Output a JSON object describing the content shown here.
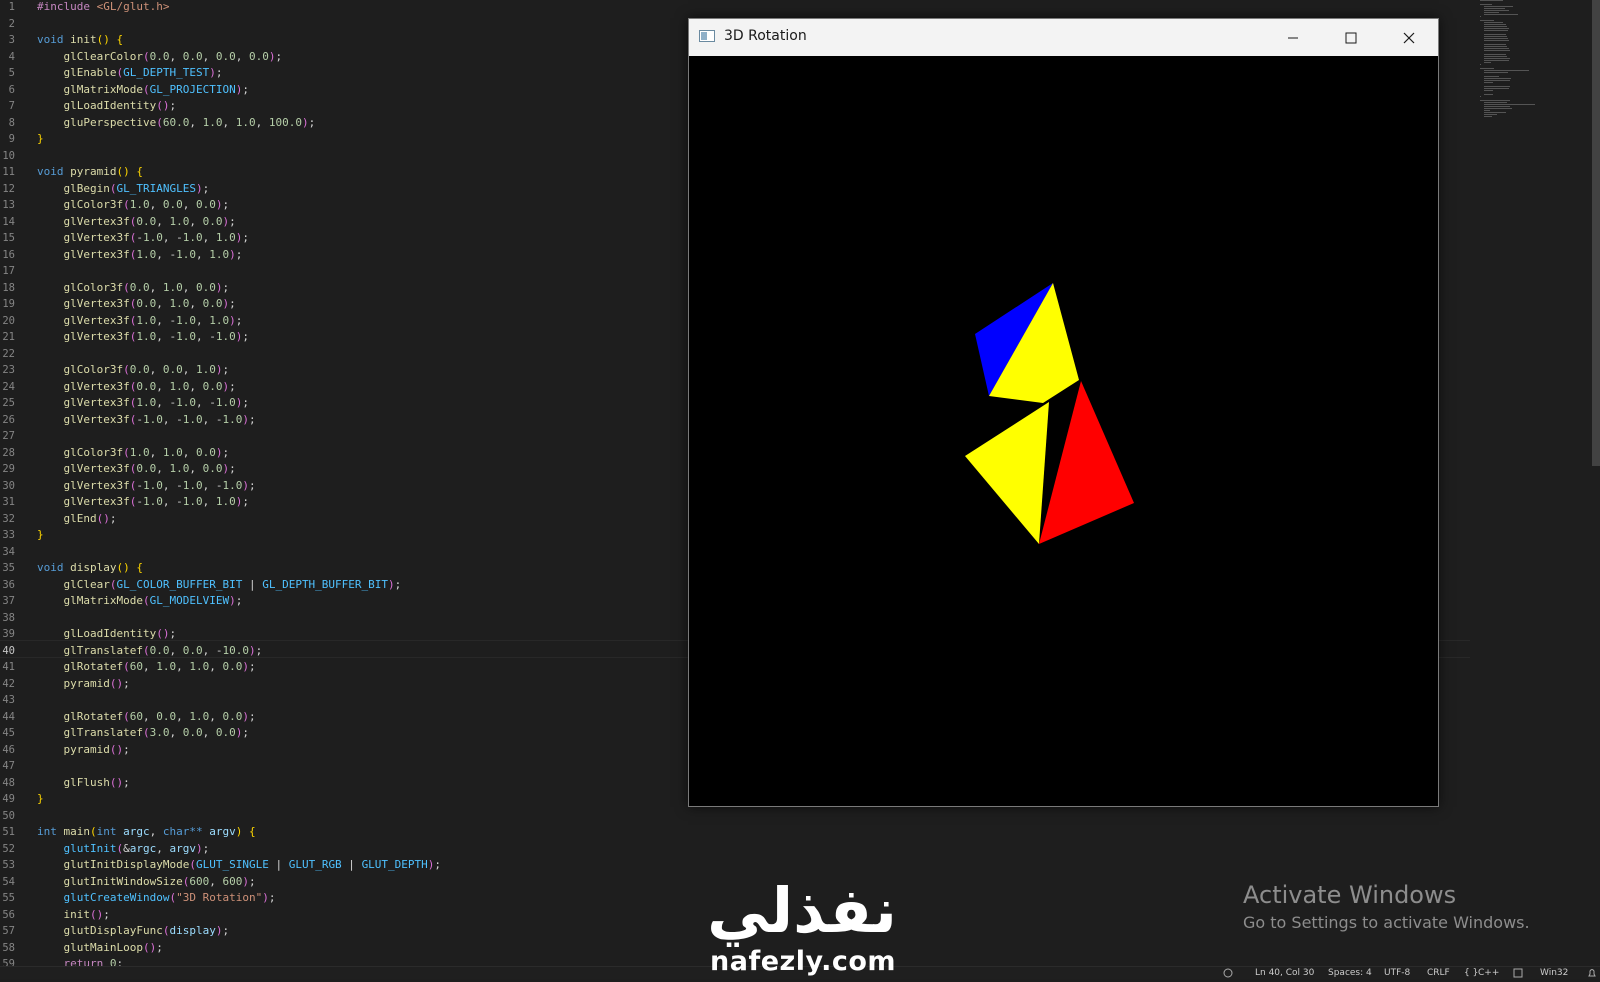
{
  "editor": {
    "active_line": "40",
    "lines": [
      {
        "n": "1",
        "html": "<span class='pre'>#include</span> <span class='s'>&lt;GL/glut.h&gt;</span>"
      },
      {
        "n": "2",
        "html": ""
      },
      {
        "n": "3",
        "html": "<span class='k'>void</span> <span class='f'>init</span><span class='b'>()</span> <span class='b'>{</span>"
      },
      {
        "n": "4",
        "html": "    <span class='f'>glClearColor</span><span class='b2'>(</span><span class='n'>0.0</span>, <span class='n'>0.0</span>, <span class='n'>0.0</span>, <span class='n'>0.0</span><span class='b2'>)</span>;"
      },
      {
        "n": "5",
        "html": "    <span class='f'>glEnable</span><span class='b2'>(</span><span class='c'>GL_DEPTH_TEST</span><span class='b2'>)</span>;"
      },
      {
        "n": "6",
        "html": "    <span class='f'>glMatrixMode</span><span class='b2'>(</span><span class='c'>GL_PROJECTION</span><span class='b2'>)</span>;"
      },
      {
        "n": "7",
        "html": "    <span class='f'>glLoadIdentity</span><span class='b2'>()</span>;"
      },
      {
        "n": "8",
        "html": "    <span class='f'>gluPerspective</span><span class='b2'>(</span><span class='n'>60.0</span>, <span class='n'>1.0</span>, <span class='n'>1.0</span>, <span class='n'>100.0</span><span class='b2'>)</span>;"
      },
      {
        "n": "9",
        "html": "<span class='b'>}</span>"
      },
      {
        "n": "10",
        "html": ""
      },
      {
        "n": "11",
        "html": "<span class='k'>void</span> <span class='f'>pyramid</span><span class='b'>()</span> <span class='b'>{</span>"
      },
      {
        "n": "12",
        "html": "    <span class='f'>glBegin</span><span class='b2'>(</span><span class='c'>GL_TRIANGLES</span><span class='b2'>)</span>;"
      },
      {
        "n": "13",
        "html": "    <span class='f'>glColor3f</span><span class='b2'>(</span><span class='n'>1.0</span>, <span class='n'>0.0</span>, <span class='n'>0.0</span><span class='b2'>)</span>;"
      },
      {
        "n": "14",
        "html": "    <span class='f'>glVertex3f</span><span class='b2'>(</span><span class='n'>0.0</span>, <span class='n'>1.0</span>, <span class='n'>0.0</span><span class='b2'>)</span>;"
      },
      {
        "n": "15",
        "html": "    <span class='f'>glVertex3f</span><span class='b2'>(</span>-<span class='n'>1.0</span>, -<span class='n'>1.0</span>, <span class='n'>1.0</span><span class='b2'>)</span>;"
      },
      {
        "n": "16",
        "html": "    <span class='f'>glVertex3f</span><span class='b2'>(</span><span class='n'>1.0</span>, -<span class='n'>1.0</span>, <span class='n'>1.0</span><span class='b2'>)</span>;"
      },
      {
        "n": "17",
        "html": ""
      },
      {
        "n": "18",
        "html": "    <span class='f'>glColor3f</span><span class='b2'>(</span><span class='n'>0.0</span>, <span class='n'>1.0</span>, <span class='n'>0.0</span><span class='b2'>)</span>;"
      },
      {
        "n": "19",
        "html": "    <span class='f'>glVertex3f</span><span class='b2'>(</span><span class='n'>0.0</span>, <span class='n'>1.0</span>, <span class='n'>0.0</span><span class='b2'>)</span>;"
      },
      {
        "n": "20",
        "html": "    <span class='f'>glVertex3f</span><span class='b2'>(</span><span class='n'>1.0</span>, -<span class='n'>1.0</span>, <span class='n'>1.0</span><span class='b2'>)</span>;"
      },
      {
        "n": "21",
        "html": "    <span class='f'>glVertex3f</span><span class='b2'>(</span><span class='n'>1.0</span>, -<span class='n'>1.0</span>, -<span class='n'>1.0</span><span class='b2'>)</span>;"
      },
      {
        "n": "22",
        "html": ""
      },
      {
        "n": "23",
        "html": "    <span class='f'>glColor3f</span><span class='b2'>(</span><span class='n'>0.0</span>, <span class='n'>0.0</span>, <span class='n'>1.0</span><span class='b2'>)</span>;"
      },
      {
        "n": "24",
        "html": "    <span class='f'>glVertex3f</span><span class='b2'>(</span><span class='n'>0.0</span>, <span class='n'>1.0</span>, <span class='n'>0.0</span><span class='b2'>)</span>;"
      },
      {
        "n": "25",
        "html": "    <span class='f'>glVertex3f</span><span class='b2'>(</span><span class='n'>1.0</span>, -<span class='n'>1.0</span>, -<span class='n'>1.0</span><span class='b2'>)</span>;"
      },
      {
        "n": "26",
        "html": "    <span class='f'>glVertex3f</span><span class='b2'>(</span>-<span class='n'>1.0</span>, -<span class='n'>1.0</span>, -<span class='n'>1.0</span><span class='b2'>)</span>;"
      },
      {
        "n": "27",
        "html": ""
      },
      {
        "n": "28",
        "html": "    <span class='f'>glColor3f</span><span class='b2'>(</span><span class='n'>1.0</span>, <span class='n'>1.0</span>, <span class='n'>0.0</span><span class='b2'>)</span>;"
      },
      {
        "n": "29",
        "html": "    <span class='f'>glVertex3f</span><span class='b2'>(</span><span class='n'>0.0</span>, <span class='n'>1.0</span>, <span class='n'>0.0</span><span class='b2'>)</span>;"
      },
      {
        "n": "30",
        "html": "    <span class='f'>glVertex3f</span><span class='b2'>(</span>-<span class='n'>1.0</span>, -<span class='n'>1.0</span>, -<span class='n'>1.0</span><span class='b2'>)</span>;"
      },
      {
        "n": "31",
        "html": "    <span class='f'>glVertex3f</span><span class='b2'>(</span>-<span class='n'>1.0</span>, -<span class='n'>1.0</span>, <span class='n'>1.0</span><span class='b2'>)</span>;"
      },
      {
        "n": "32",
        "html": "    <span class='f'>glEnd</span><span class='b2'>()</span>;"
      },
      {
        "n": "33",
        "html": "<span class='b'>}</span>"
      },
      {
        "n": "34",
        "html": ""
      },
      {
        "n": "35",
        "html": "<span class='k'>void</span> <span class='f'>display</span><span class='b'>()</span> <span class='b'>{</span>"
      },
      {
        "n": "36",
        "html": "    <span class='f'>glClear</span><span class='b2'>(</span><span class='c'>GL_COLOR_BUFFER_BIT</span> | <span class='c'>GL_DEPTH_BUFFER_BIT</span><span class='b2'>)</span>;"
      },
      {
        "n": "37",
        "html": "    <span class='f'>glMatrixMode</span><span class='b2'>(</span><span class='c'>GL_MODELVIEW</span><span class='b2'>)</span>;"
      },
      {
        "n": "38",
        "html": ""
      },
      {
        "n": "39",
        "html": "    <span class='f'>glLoadIdentity</span><span class='b2'>()</span>;"
      },
      {
        "n": "40",
        "html": "    <span class='f'>glTranslatef</span><span class='b2'>(</span><span class='n'>0.0</span>, <span class='n'>0.0</span>, -<span class='n'>10.0</span><span class='b2'>)</span>;"
      },
      {
        "n": "41",
        "html": "    <span class='f'>glRotatef</span><span class='b2'>(</span><span class='n'>60</span>, <span class='n'>1.0</span>, <span class='n'>1.0</span>, <span class='n'>0.0</span><span class='b2'>)</span>;"
      },
      {
        "n": "42",
        "html": "    <span class='f'>pyramid</span><span class='b2'>()</span>;"
      },
      {
        "n": "43",
        "html": ""
      },
      {
        "n": "44",
        "html": "    <span class='f'>glRotatef</span><span class='b2'>(</span><span class='n'>60</span>, <span class='n'>0.0</span>, <span class='n'>1.0</span>, <span class='n'>0.0</span><span class='b2'>)</span>;"
      },
      {
        "n": "45",
        "html": "    <span class='f'>glTranslatef</span><span class='b2'>(</span><span class='n'>3.0</span>, <span class='n'>0.0</span>, <span class='n'>0.0</span><span class='b2'>)</span>;"
      },
      {
        "n": "46",
        "html": "    <span class='f'>pyramid</span><span class='b2'>()</span>;"
      },
      {
        "n": "47",
        "html": ""
      },
      {
        "n": "48",
        "html": "    <span class='f'>glFlush</span><span class='b2'>()</span>;"
      },
      {
        "n": "49",
        "html": "<span class='b'>}</span>"
      },
      {
        "n": "50",
        "html": ""
      },
      {
        "n": "51",
        "html": "<span class='k'>int</span> <span class='f'>main</span><span class='b'>(</span><span class='k'>int</span> <span class='v'>argc</span>, <span class='k'>char**</span> <span class='v'>argv</span><span class='b'>)</span> <span class='b'>{</span>"
      },
      {
        "n": "52",
        "html": "    <span class='c'>glutInit</span><span class='b2'>(</span>&amp;<span class='v'>argc</span>, <span class='v'>argv</span><span class='b2'>)</span>;"
      },
      {
        "n": "53",
        "html": "    <span class='f'>glutInitDisplayMode</span><span class='b2'>(</span><span class='c'>GLUT_SINGLE</span> | <span class='c'>GLUT_RGB</span> | <span class='c'>GLUT_DEPTH</span><span class='b2'>)</span>;"
      },
      {
        "n": "54",
        "html": "    <span class='f'>glutInitWindowSize</span><span class='b2'>(</span><span class='n'>600</span>, <span class='n'>600</span><span class='b2'>)</span>;"
      },
      {
        "n": "55",
        "html": "    <span class='c'>glutCreateWindow</span><span class='b2'>(</span><span class='s'>\"3D Rotation\"</span><span class='b2'>)</span>;"
      },
      {
        "n": "56",
        "html": "    <span class='f'>init</span><span class='b2'>()</span>;"
      },
      {
        "n": "57",
        "html": "    <span class='f'>glutDisplayFunc</span><span class='b2'>(</span><span class='v'>display</span><span class='b2'>)</span>;"
      },
      {
        "n": "58",
        "html": "    <span class='f'>glutMainLoop</span><span class='b2'>()</span>;"
      },
      {
        "n": "59",
        "html": "    <span class='pre'>return</span> <span class='n'>0</span>;"
      }
    ]
  },
  "glut_window": {
    "title": "3D Rotation",
    "minimize_icon": "minimize-icon",
    "maximize_icon": "maximize-icon",
    "close_icon": "close-icon",
    "colors": {
      "blue": "#0000ff",
      "yellow": "#ffff00",
      "red": "#ff0000",
      "background": "#000000"
    }
  },
  "statusbar": {
    "position": "Ln 40, Col 30",
    "spaces": "Spaces: 4",
    "encoding": "UTF-8",
    "eol": "CRLF",
    "language": "C++",
    "platform": "Win32"
  },
  "activation_watermark": {
    "title": "Activate Windows",
    "subtitle": "Go to Settings to activate Windows."
  },
  "logo": {
    "arabic_text": "نفذلي",
    "url": "nafezly.com"
  }
}
